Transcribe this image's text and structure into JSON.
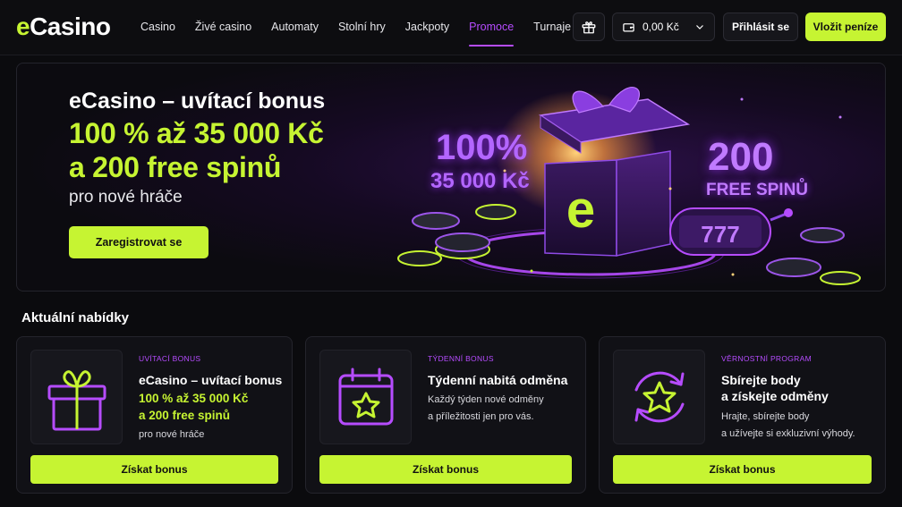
{
  "brand": {
    "logo_e": "e",
    "logo_rest": "Casino",
    "accent": "#c6f432",
    "purple": "#b64cff"
  },
  "nav": {
    "items": [
      {
        "label": "Casino",
        "active": false
      },
      {
        "label": "Živé casino",
        "active": false
      },
      {
        "label": "Automaty",
        "active": false
      },
      {
        "label": "Stolní hry",
        "active": false
      },
      {
        "label": "Jackpoty",
        "active": false
      },
      {
        "label": "Promoce",
        "active": true
      },
      {
        "label": "Turnaje",
        "active": false
      }
    ]
  },
  "header": {
    "balance": "0,00 Kč",
    "login_label": "Přihlásit se",
    "deposit_label": "Vložit peníze"
  },
  "hero": {
    "title": "eCasino – uvítací bonus",
    "line1": "100 % až 35 000 Kč",
    "line2": "a 200 free spinů",
    "subtitle": "pro nové hráče",
    "cta_label": "Zaregistrovat se",
    "art": {
      "pct": "100%",
      "pct_amount": "35 000 Kč",
      "spins_count": "200",
      "spins_label": "FREE SPINŮ",
      "box_logo": "e",
      "slot_digits": "777"
    }
  },
  "offers": {
    "title": "Aktuální nabídky",
    "cards": [
      {
        "tag": "Uvítací bonus",
        "title": "eCasino – uvítací bonus",
        "line1": "100 % až 35 000 Kč",
        "line2": "a 200 free spinů",
        "text1": "pro nové hráče",
        "button": "Získat bonus",
        "icon": "gift-icon"
      },
      {
        "tag": "Týdenní bonus",
        "title": "Týdenní nabitá odměna",
        "text1": "Každý týden nové odměny",
        "text2": "a příležitosti jen pro vás.",
        "button": "Získat bonus",
        "icon": "calendar-star-icon"
      },
      {
        "tag": "Věrnostní program",
        "title": "Sbírejte body",
        "title2": "a získejte odměny",
        "text1": "Hrajte, sbírejte body",
        "text2": "a užívejte si exkluzivní výhody.",
        "button": "Získat bonus",
        "icon": "star-cycle-icon"
      }
    ]
  }
}
